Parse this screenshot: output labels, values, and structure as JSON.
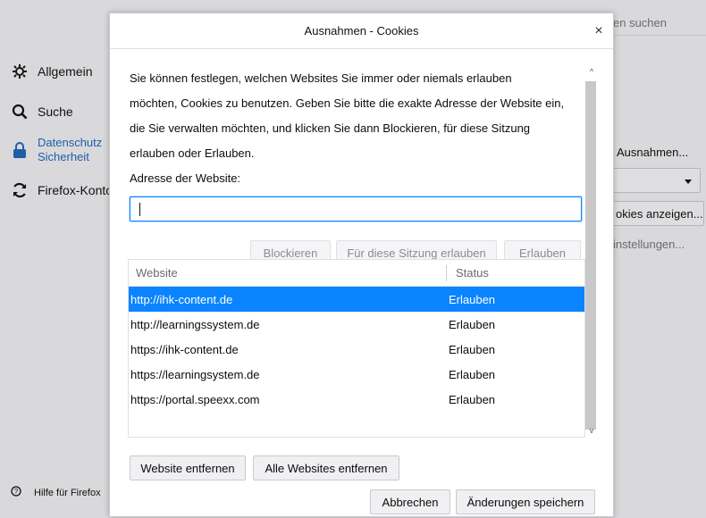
{
  "background": {
    "search_placeholder": "en suchen",
    "sidebar": [
      {
        "icon": "gear-icon",
        "label": "Allgemein"
      },
      {
        "icon": "search-icon",
        "label": "Suche"
      },
      {
        "icon": "lock-icon",
        "label_line1": "Datenschutz",
        "label_line2": "Sicherheit"
      },
      {
        "icon": "sync-icon",
        "label": "Firefox-Konto"
      }
    ],
    "help_label": "Hilfe für Firefox",
    "right": {
      "exceptions_button": "Ausnahmen...",
      "show_cookies_button": "okies anzeigen...",
      "settings_text": "instellungen..."
    }
  },
  "dialog": {
    "title": "Ausnahmen - Cookies",
    "close_symbol": "×",
    "description_lines": [
      "Sie können festlegen, welchen Websites Sie immer oder niemals erlauben",
      "möchten, Cookies zu benutzen. Geben Sie bitte die exakte Adresse der Website ein,",
      "die Sie verwalten möchten, und klicken Sie dann Blockieren, für diese Sitzung",
      "erlauben oder Erlauben."
    ],
    "address_label": "Adresse der Website:",
    "address_value": "",
    "buttons": {
      "block": "Blockieren",
      "allow_session": "Für diese Sitzung erlauben",
      "allow": "Erlauben",
      "remove_site": "Website entfernen",
      "remove_all": "Alle Websites entfernen",
      "cancel": "Abbrechen",
      "save": "Änderungen speichern"
    },
    "table": {
      "headers": {
        "site": "Website",
        "status": "Status"
      },
      "rows": [
        {
          "site": "http://ihk-content.de",
          "status": "Erlauben",
          "selected": true
        },
        {
          "site": "http://learningssystem.de",
          "status": "Erlauben",
          "selected": false
        },
        {
          "site": "https://ihk-content.de",
          "status": "Erlauben",
          "selected": false
        },
        {
          "site": "https://learningsystem.de",
          "status": "Erlauben",
          "selected": false
        },
        {
          "site": "https://portal.speexx.com",
          "status": "Erlauben",
          "selected": false
        }
      ]
    }
  },
  "colors": {
    "accent": "#0a84ff",
    "active_sidebar": "#1f5ea8"
  }
}
